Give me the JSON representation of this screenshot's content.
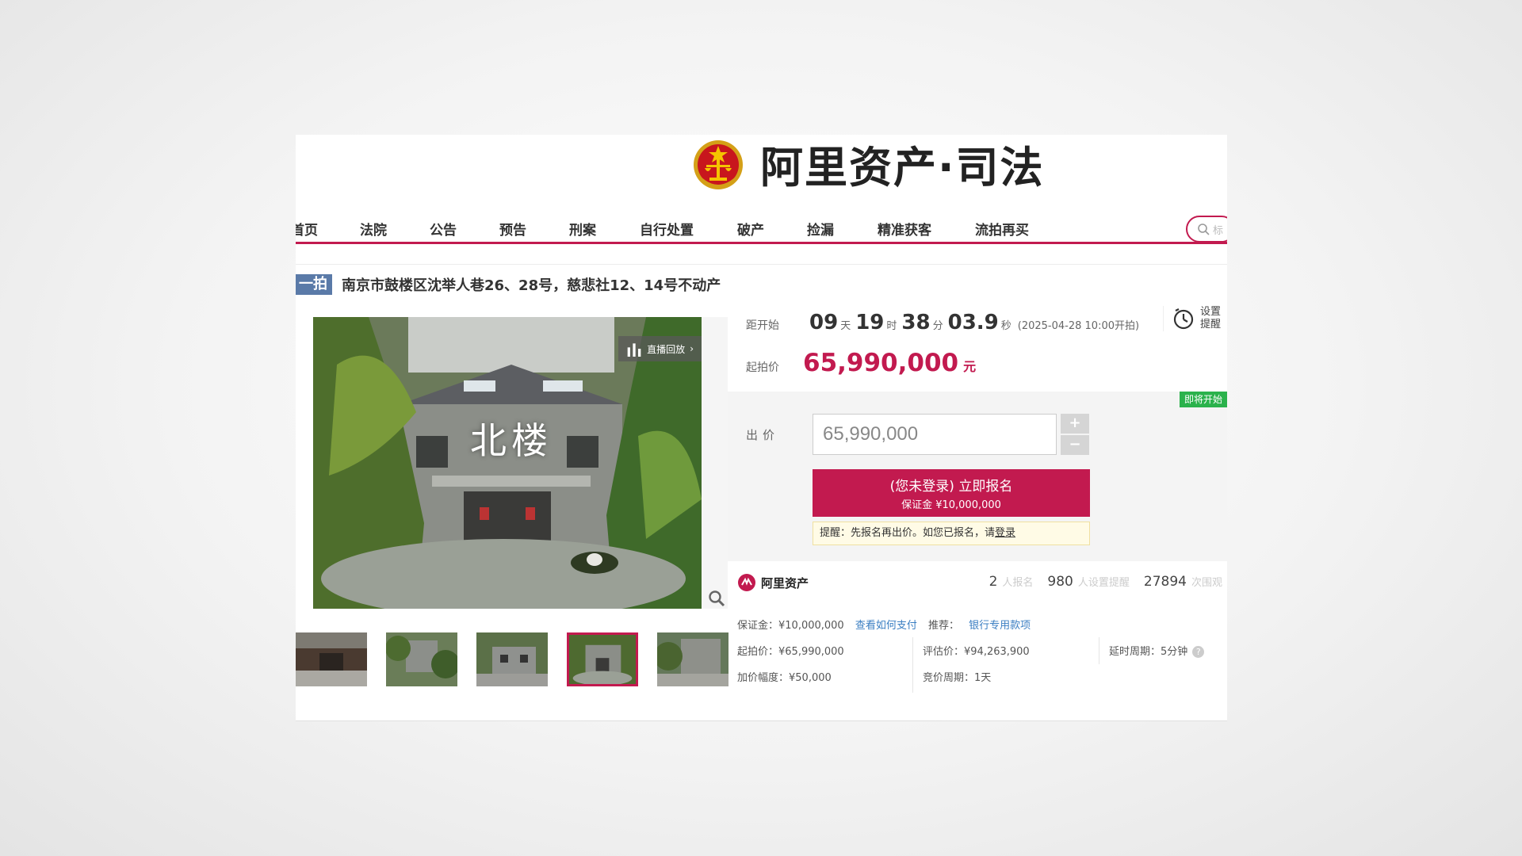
{
  "header": {
    "brand_name": "阿里资产·司法",
    "emblem_icon": "court-emblem-icon",
    "search_placeholder": "标"
  },
  "nav": {
    "items": [
      "首页",
      "法院",
      "公告",
      "预告",
      "刑案",
      "自行处置",
      "破产",
      "捡漏",
      "精准获客",
      "流拍再买"
    ]
  },
  "title": {
    "tag": "一拍",
    "text": "南京市鼓楼区沈举人巷26、28号，慈悲社12、14号不动产"
  },
  "gallery": {
    "replay_label": "直播回放",
    "image_caption": "北楼",
    "thumb_count": 5,
    "active_thumb": 4
  },
  "countdown": {
    "label": "距开始",
    "days": "09",
    "days_unit": "天",
    "hours": "19",
    "hours_unit": "时",
    "minutes": "38",
    "minutes_unit": "分",
    "seconds": "03.9",
    "seconds_unit": "秒",
    "start_note": "(2025-04-28 10:00开拍)"
  },
  "reminder": {
    "line1": "设置",
    "line2": "提醒"
  },
  "start_price": {
    "label": "起拍价",
    "value": "65,990,000",
    "unit": "元"
  },
  "bid": {
    "status_tag": "即将开始",
    "label": "出价",
    "input_value": "65,990,000",
    "plus": "+",
    "minus": "−",
    "register_line1": "(您未登录) 立即报名",
    "register_line2": "保证金 ¥10,000,000",
    "tip_prefix": "提醒：先报名再出价。如您已报名，请",
    "tip_link": "登录"
  },
  "stats": {
    "brand": "阿里资产",
    "registered": "2",
    "registered_label": "人报名",
    "reminders": "980",
    "reminders_label": "人设置提醒",
    "views": "27894",
    "views_label": "次围观"
  },
  "info": {
    "deposit": "保证金：¥10,000,000",
    "how_to_pay": "查看如何支付",
    "recommend_label": "推荐：",
    "recommend_link": "银行专用款项",
    "start_price": "起拍价：¥65,990,000",
    "appraisal": "评估价：¥94,263,900",
    "delay": "延时周期：5分钟",
    "increment": "加价幅度：¥50,000",
    "bid_period": "竞价周期：1天"
  },
  "colors": {
    "accent": "#c21a4f",
    "tag_blue": "#5a7aa8",
    "soon_green": "#2bb24c",
    "link_blue": "#3a7ec2"
  }
}
